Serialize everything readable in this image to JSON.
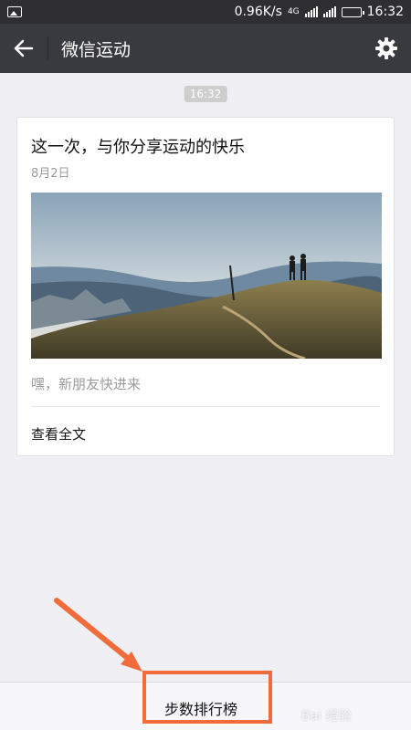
{
  "status_bar": {
    "network_speed": "0.96K/s",
    "network_type": "4G",
    "time": "16:32"
  },
  "nav": {
    "title": "微信运动"
  },
  "chat": {
    "timestamp": "16:32"
  },
  "card": {
    "title": "这一次，与你分享运动的快乐",
    "date": "8月2日",
    "description": "嘿，新朋友快进来",
    "read_more": "查看全文"
  },
  "bottom": {
    "button_label": "步数排行榜"
  },
  "watermark": "Bai 经验",
  "colors": {
    "nav_bg": "#393a3f",
    "page_bg": "#efeff4",
    "highlight": "#f26b3a"
  }
}
